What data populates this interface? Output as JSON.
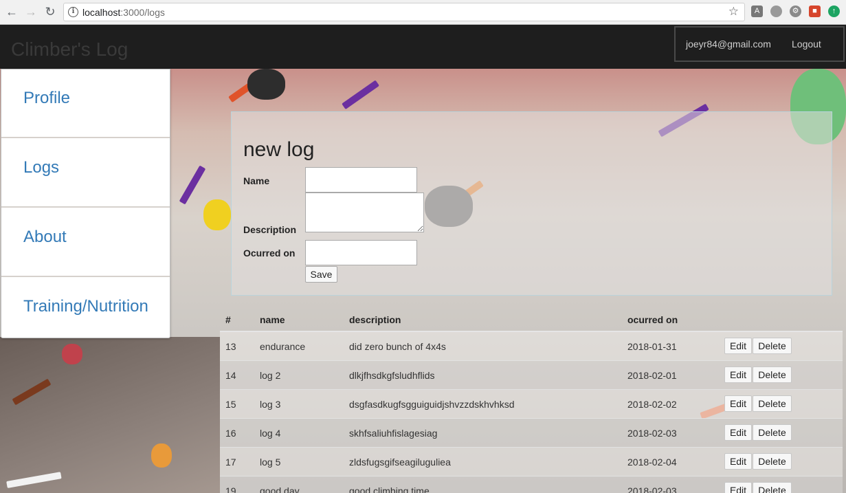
{
  "browser": {
    "url_host": "localhost",
    "url_path": ":3000/logs"
  },
  "header": {
    "brand": "Climber's Log",
    "user_email": "joeyr84@gmail.com",
    "logout_label": "Logout"
  },
  "sidebar": {
    "items": [
      {
        "label": "Profile"
      },
      {
        "label": "Logs"
      },
      {
        "label": "About"
      },
      {
        "label": "Training/Nutrition"
      }
    ]
  },
  "form": {
    "title": "new log",
    "name_label": "Name",
    "description_label": "Description",
    "ocurred_label": "Ocurred on",
    "save_label": "Save",
    "name_value": "",
    "description_value": "",
    "ocurred_value": ""
  },
  "table": {
    "headers": [
      "#",
      "name",
      "description",
      "ocurred on"
    ],
    "edit_label": "Edit",
    "delete_label": "Delete",
    "rows": [
      {
        "id": "13",
        "name": "endurance",
        "description": "did zero bunch of 4x4s",
        "ocurred": "2018-01-31"
      },
      {
        "id": "14",
        "name": "log 2",
        "description": "dlkjfhsdkgfsludhflids",
        "ocurred": "2018-02-01"
      },
      {
        "id": "15",
        "name": "log 3",
        "description": "dsgfasdkugfsgguiguidjshvzzdskhvhksd",
        "ocurred": "2018-02-02"
      },
      {
        "id": "16",
        "name": "log 4",
        "description": "skhfsaliuhfislagesiag",
        "ocurred": "2018-02-03"
      },
      {
        "id": "17",
        "name": "log 5",
        "description": "zldsfugsgifseagiluguliea",
        "ocurred": "2018-02-04"
      },
      {
        "id": "19",
        "name": "good day",
        "description": "good climbing time",
        "ocurred": "2018-02-03"
      }
    ]
  },
  "colors": {
    "accent_link": "#337ab7",
    "appbar": "#1e1e1e"
  }
}
